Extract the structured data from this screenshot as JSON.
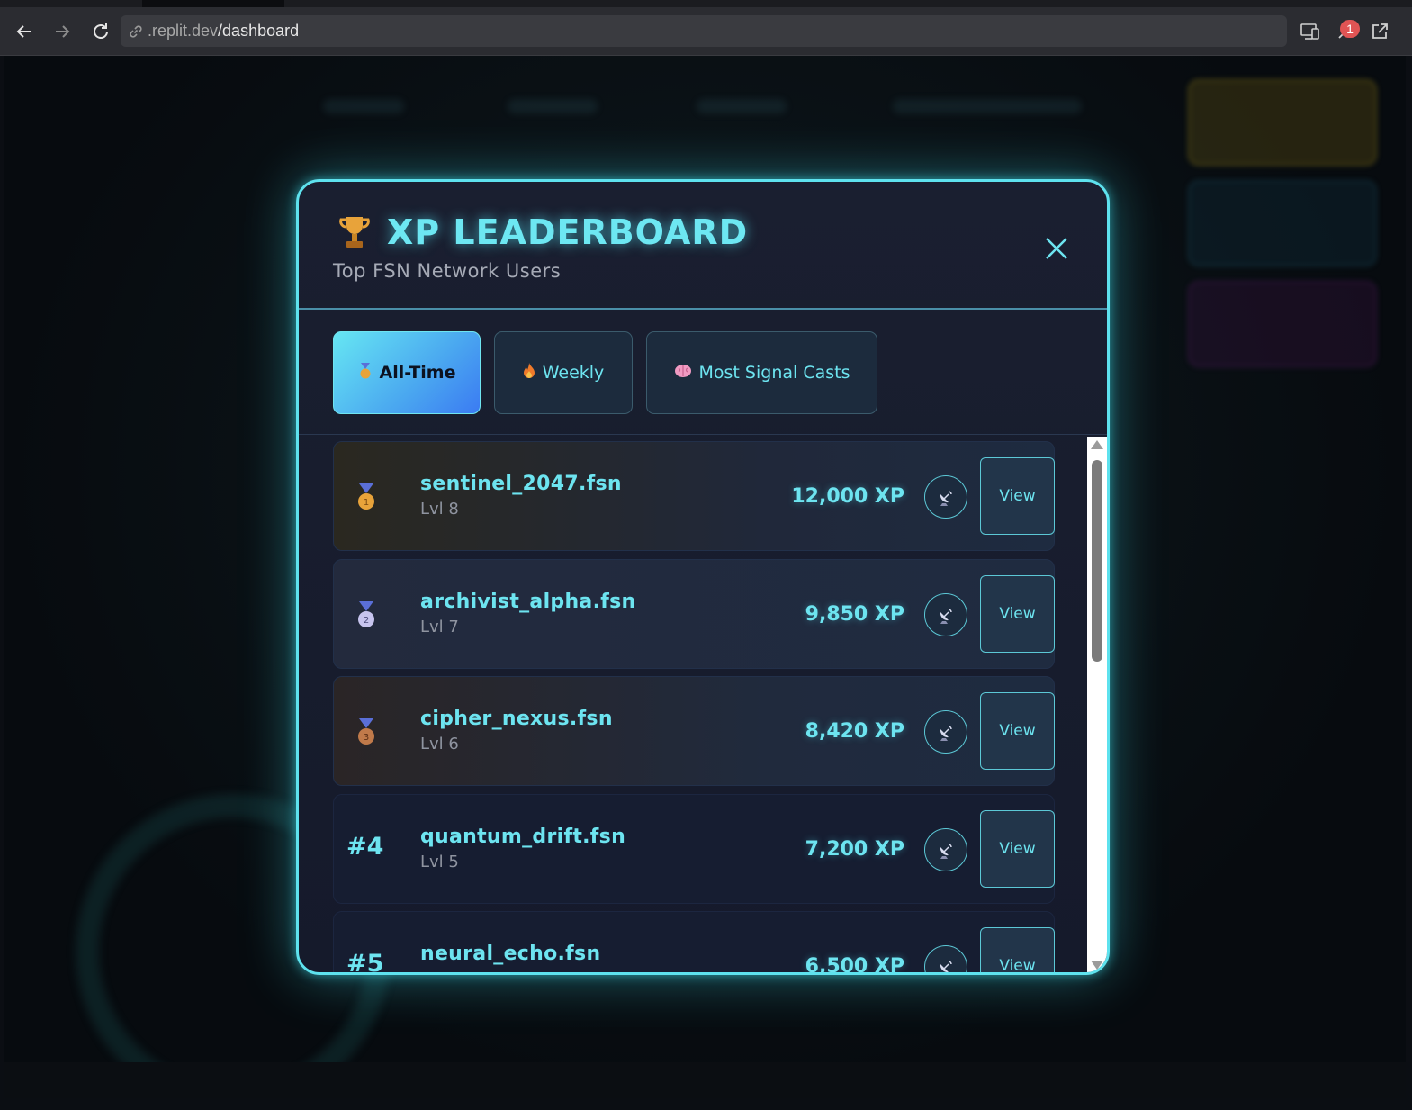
{
  "browser": {
    "url_host": ".replit.dev",
    "url_path": "/dashboard",
    "notification_count": "1"
  },
  "modal": {
    "title": "XP LEADERBOARD",
    "subtitle": "Top FSN Network Users",
    "tabs": [
      {
        "label": "All-Time",
        "icon": "medal-icon",
        "active": true
      },
      {
        "label": "Weekly",
        "icon": "fire-icon",
        "active": false
      },
      {
        "label": "Most Signal Casts",
        "icon": "brain-icon",
        "active": false
      }
    ],
    "rows": [
      {
        "rank": "1",
        "medal": "gold",
        "name": "sentinel_2047.fsn",
        "level": "Lvl 8",
        "xp": "12,000 XP",
        "view_label": "View"
      },
      {
        "rank": "2",
        "medal": "silver",
        "name": "archivist_alpha.fsn",
        "level": "Lvl 7",
        "xp": "9,850 XP",
        "view_label": "View"
      },
      {
        "rank": "3",
        "medal": "bronze",
        "name": "cipher_nexus.fsn",
        "level": "Lvl 6",
        "xp": "8,420 XP",
        "view_label": "View"
      },
      {
        "rank": "#4",
        "medal": "none",
        "name": "quantum_drift.fsn",
        "level": "Lvl 5",
        "xp": "7,200 XP",
        "view_label": "View"
      },
      {
        "rank": "#5",
        "medal": "none",
        "name": "neural_echo.fsn",
        "level": "",
        "xp": "6,500 XP",
        "view_label": "View"
      }
    ]
  },
  "colors": {
    "accent": "#6de4f0",
    "modal_border": "#5ee2ee",
    "gold": "#e8a33a",
    "silver": "#b9b6e8",
    "bronze": "#c07a4a"
  }
}
